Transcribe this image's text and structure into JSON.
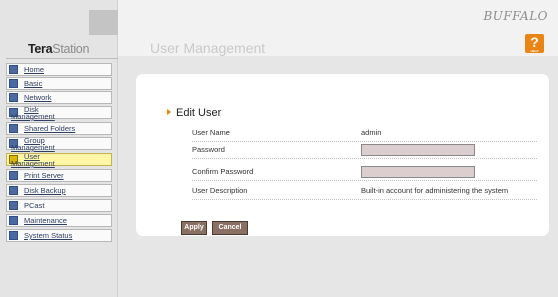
{
  "sidebar": {
    "logo_bold": "Tera",
    "logo_light": "Station",
    "items": [
      {
        "label_1": "Home",
        "label_2": ""
      },
      {
        "label_1": "Basic",
        "label_2": ""
      },
      {
        "label_1": "Network",
        "label_2": ""
      },
      {
        "label_1": "Disk",
        "label_2": "Management"
      },
      {
        "label_1": "Shared Folders",
        "label_2": ""
      },
      {
        "label_1": "Group",
        "label_2": "Management"
      },
      {
        "label_1": "User",
        "label_2": "Management"
      },
      {
        "label_1": "Print Server",
        "label_2": ""
      },
      {
        "label_1": "Disk Backup",
        "label_2": ""
      },
      {
        "label_1": "PCast",
        "label_2": ""
      },
      {
        "label_1": "Maintenance",
        "label_2": ""
      },
      {
        "label_1": "System Status",
        "label_2": ""
      }
    ]
  },
  "header": {
    "brand": "BUFFALO",
    "page_title": "User Management",
    "help_symbol": "?",
    "help_caption": "HELP"
  },
  "form": {
    "section_title": "Edit User",
    "user_name_label": "User Name",
    "user_name_value": "admin",
    "password_label": "Password",
    "password_value": "",
    "confirm_password_label": "Confirm Password",
    "confirm_password_value": "",
    "description_label": "User Description",
    "description_value": "Built-in account for administering the system",
    "apply_label": "Apply",
    "cancel_label": "Cancel"
  },
  "colors": {
    "active_menu": "#fff6a8",
    "help_button": "#e88514",
    "button_brown": "#8a6f63",
    "input_bg": "#dccece"
  }
}
